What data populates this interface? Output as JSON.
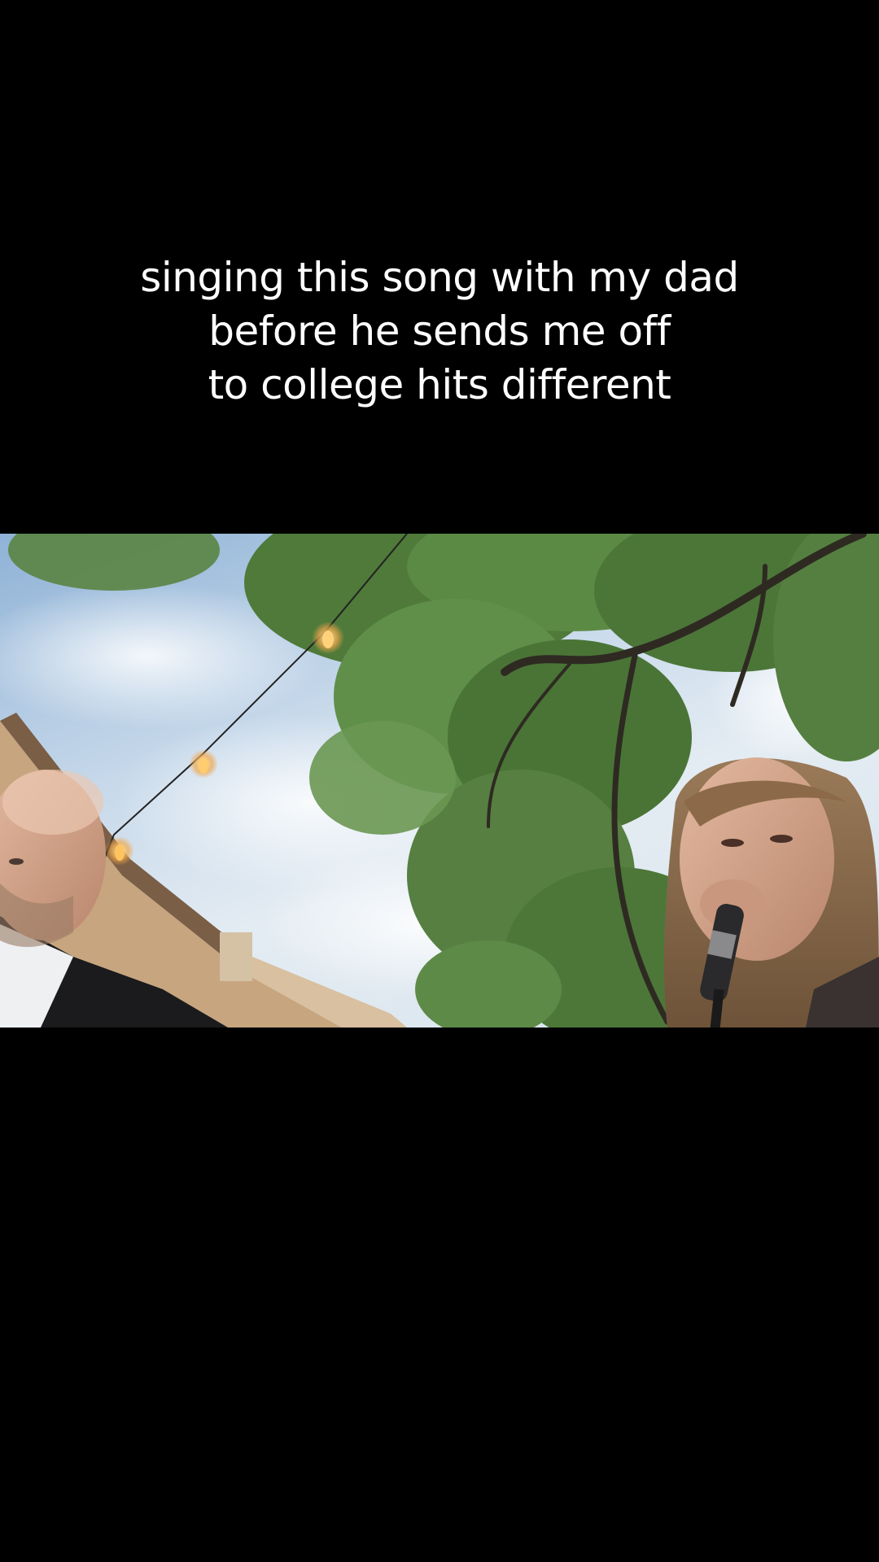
{
  "caption": {
    "line1": "singing this song with my dad",
    "line2": "before he sends me off",
    "line3": "to college hits different"
  },
  "colors": {
    "background": "#000000",
    "caption_text": "#ffffff",
    "sky": "#c6d8ea",
    "foliage": "#4f7a3a"
  },
  "scene": {
    "subjects": [
      "man",
      "girl-singing-with-microphone"
    ],
    "elements": [
      "tree-canopy",
      "string-lights",
      "house-roof",
      "cloudy-sky"
    ]
  }
}
